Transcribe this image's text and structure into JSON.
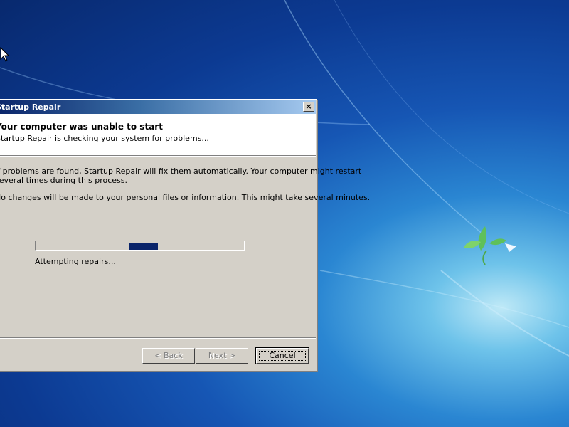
{
  "window": {
    "title": "Startup Repair",
    "close_glyph": "×"
  },
  "header": {
    "title": "Your computer was unable to start",
    "subtitle": "Startup Repair is checking your system for problems..."
  },
  "body": {
    "line1": "If problems are found, Startup Repair will fix them automatically. Your computer might restart",
    "line2": "several times during this process.",
    "line3": "No changes will be made to your personal files or information. This might take several minutes."
  },
  "progress": {
    "status": "Attempting repairs...",
    "chunk_position_fraction": 0.52
  },
  "buttons": {
    "back": "< Back",
    "next": "Next >",
    "cancel": "Cancel"
  },
  "colors": {
    "titlebar": "#0a246a",
    "dialog_bg": "#d4d0c8",
    "progress": "#0a246a"
  }
}
